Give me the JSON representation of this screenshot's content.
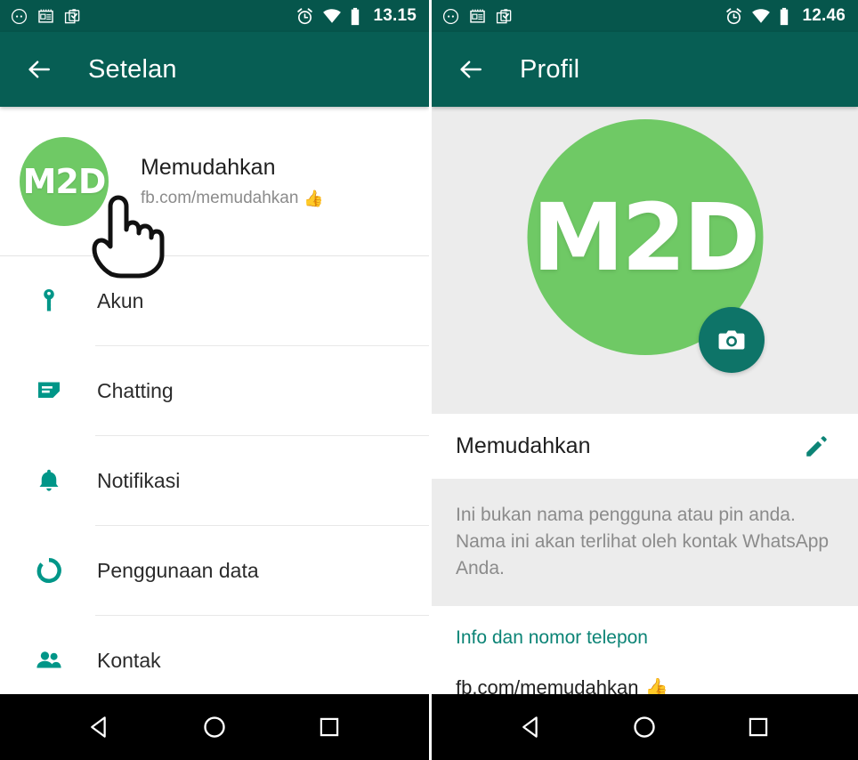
{
  "colors": {
    "status_bar": "#06564C",
    "app_bar": "#075E54",
    "accent_teal": "#009688",
    "link_teal": "#0C8476",
    "avatar_green": "#6FC965",
    "fab_teal": "#0E7468",
    "panel_grey": "#ececec"
  },
  "left_screen": {
    "status_bar": {
      "time": "13.15",
      "icons": [
        "dnd-dots-icon",
        "calendar-news-icon",
        "clipboard-check-icon",
        "alarm-icon",
        "wifi-icon",
        "battery-icon"
      ]
    },
    "app_bar": {
      "back_icon": "arrow-back-icon",
      "title": "Setelan"
    },
    "profile": {
      "avatar_text": "M2D",
      "name": "Memudahkan",
      "status": "fb.com/memudahkan",
      "status_emoji": "👍"
    },
    "settings_items": [
      {
        "icon": "key-icon",
        "label": "Akun"
      },
      {
        "icon": "chat-bubble-icon",
        "label": "Chatting"
      },
      {
        "icon": "bell-icon",
        "label": "Notifikasi"
      },
      {
        "icon": "data-usage-icon",
        "label": "Penggunaan data"
      },
      {
        "icon": "contacts-icon",
        "label": "Kontak"
      }
    ],
    "nav_bar": {
      "back": "nav-back-icon",
      "home": "nav-home-icon",
      "recents": "nav-recents-icon"
    }
  },
  "right_screen": {
    "status_bar": {
      "time": "12.46",
      "icons": [
        "dnd-dots-icon",
        "calendar-news-icon",
        "clipboard-check-icon",
        "alarm-icon",
        "wifi-icon",
        "battery-icon"
      ]
    },
    "app_bar": {
      "back_icon": "arrow-back-icon",
      "title": "Profil"
    },
    "photo": {
      "avatar_text": "M2D",
      "camera_button": "camera-icon"
    },
    "name_row": {
      "name": "Memudahkan",
      "edit_icon": "pencil-edit-icon"
    },
    "info_hint": "Ini bukan nama pengguna atau pin anda.\nNama ini akan terlihat oleh kontak WhatsApp Anda.",
    "about": {
      "label": "Info dan nomor telepon",
      "value": "fb.com/memudahkan",
      "value_emoji": "👍"
    },
    "nav_bar": {
      "back": "nav-back-icon",
      "home": "nav-home-icon",
      "recents": "nav-recents-icon"
    }
  }
}
